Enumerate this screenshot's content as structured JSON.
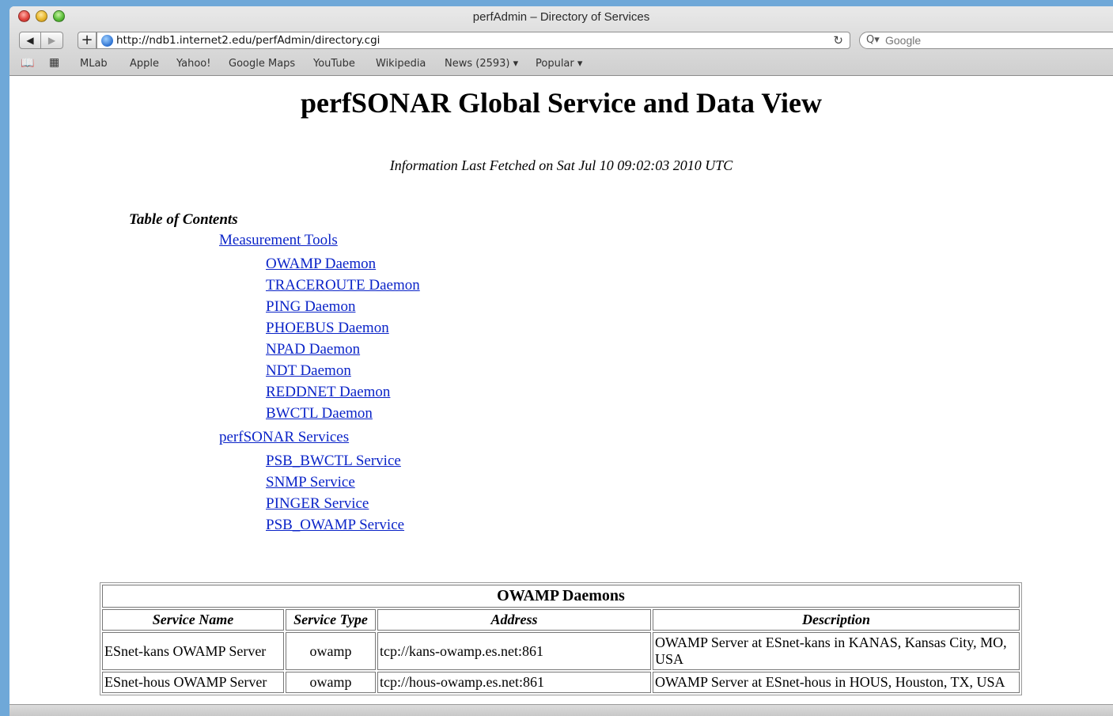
{
  "window": {
    "title": "perfAdmin – Directory of Services"
  },
  "toolbar": {
    "back_glyph": "◀",
    "forward_glyph": "▶",
    "add_glyph": "+",
    "url": "http://ndb1.internet2.edu/perfAdmin/directory.cgi",
    "reload_glyph": "↻",
    "search_placeholder": "Google",
    "search_glyph": "Q▾"
  },
  "bookmarks": {
    "items": [
      "MLab",
      "Apple",
      "Yahoo!",
      "Google Maps",
      "YouTube",
      "Wikipedia",
      "News (2593) ▾",
      "Popular ▾"
    ]
  },
  "page": {
    "title": "perfSONAR Global Service and Data View",
    "fetched": "Information Last Fetched on Sat Jul 10 09:02:03 2010 UTC",
    "toc_heading": "Table of Contents",
    "toc": {
      "measurement_tools": "Measurement Tools",
      "tools": [
        "OWAMP Daemon",
        "TRACEROUTE Daemon",
        "PING Daemon",
        "PHOEBUS Daemon",
        "NPAD Daemon",
        "NDT Daemon",
        "REDDNET Daemon",
        "BWCTL Daemon"
      ],
      "perfsonar_services": "perfSONAR Services",
      "services": [
        "PSB_BWCTL Service",
        "SNMP Service",
        "PINGER Service",
        "PSB_OWAMP Service"
      ]
    },
    "table": {
      "caption": "OWAMP Daemons",
      "headers": [
        "Service Name",
        "Service Type",
        "Address",
        "Description"
      ],
      "rows": [
        [
          "ESnet-kans OWAMP Server",
          "owamp",
          "tcp://kans-owamp.es.net:861",
          "OWAMP Server at ESnet-kans in KANAS, Kansas City, MO, USA"
        ],
        [
          "ESnet-hous OWAMP Server",
          "owamp",
          "tcp://hous-owamp.es.net:861",
          "OWAMP Server at ESnet-hous in HOUS, Houston, TX, USA"
        ]
      ]
    }
  }
}
